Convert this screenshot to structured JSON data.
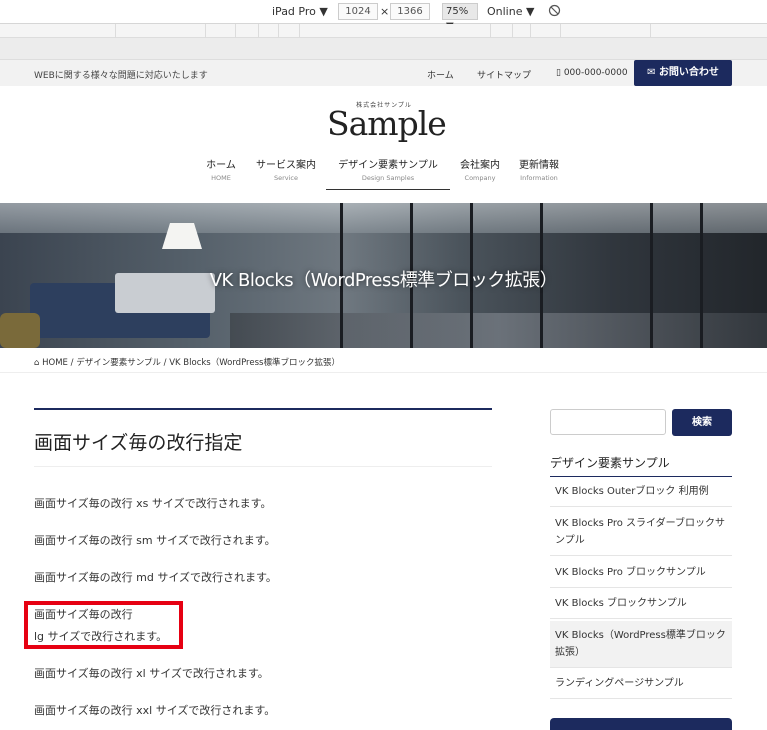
{
  "devtools": {
    "device": "iPad Pro",
    "width": "1024",
    "separator": "×",
    "height": "1366",
    "zoom": "75%",
    "network": "Online"
  },
  "header": {
    "tagline": "WEBに関する様々な問題に対応いたします",
    "links": [
      "ホーム",
      "サイトマップ"
    ],
    "phone": "000-000-0000",
    "contact_button": "お問い合わせ",
    "logo_small": "株式会社サンプル",
    "logo_big": "Sample"
  },
  "nav": [
    {
      "ja": "ホーム",
      "en": "HOME"
    },
    {
      "ja": "サービス案内",
      "en": "Service"
    },
    {
      "ja": "デザイン要素サンプル",
      "en": "Design Samples"
    },
    {
      "ja": "会社案内",
      "en": "Company"
    },
    {
      "ja": "更新情報",
      "en": "Information"
    }
  ],
  "hero": {
    "title": "VK Blocks（WordPress標準ブロック拡張）"
  },
  "breadcrumb": {
    "home": "HOME",
    "sep1": "/",
    "crumb2": "デザイン要素サンプル",
    "sep2": "/",
    "crumb3": "VK Blocks（WordPress標準ブロック拡張）"
  },
  "main": {
    "heading": "画面サイズ毎の改行指定",
    "paragraphs": [
      "画面サイズ毎の改行 xs サイズで改行されます。",
      "画面サイズ毎の改行 sm サイズで改行されます。",
      "画面サイズ毎の改行 md サイズで改行されます。",
      "画面サイズ毎の改行",
      "lg サイズで改行されます。",
      "画面サイズ毎の改行 xl サイズで改行されます。",
      "画面サイズ毎の改行 xxl サイズで改行されます。"
    ]
  },
  "sidebar": {
    "search_button": "検索",
    "title": "デザイン要素サンプル",
    "items": [
      "VK Blocks Outerブロック 利用例",
      "VK Blocks Pro スライダーブロックサンプル",
      "VK Blocks Pro ブロックサンプル",
      "VK Blocks ブロックサンプル",
      "VK Blocks（WordPress標準ブロック拡張）",
      "ランディングページサンプル"
    ]
  },
  "colors": {
    "accent": "#1c2a5e",
    "highlight": "#e60012"
  }
}
